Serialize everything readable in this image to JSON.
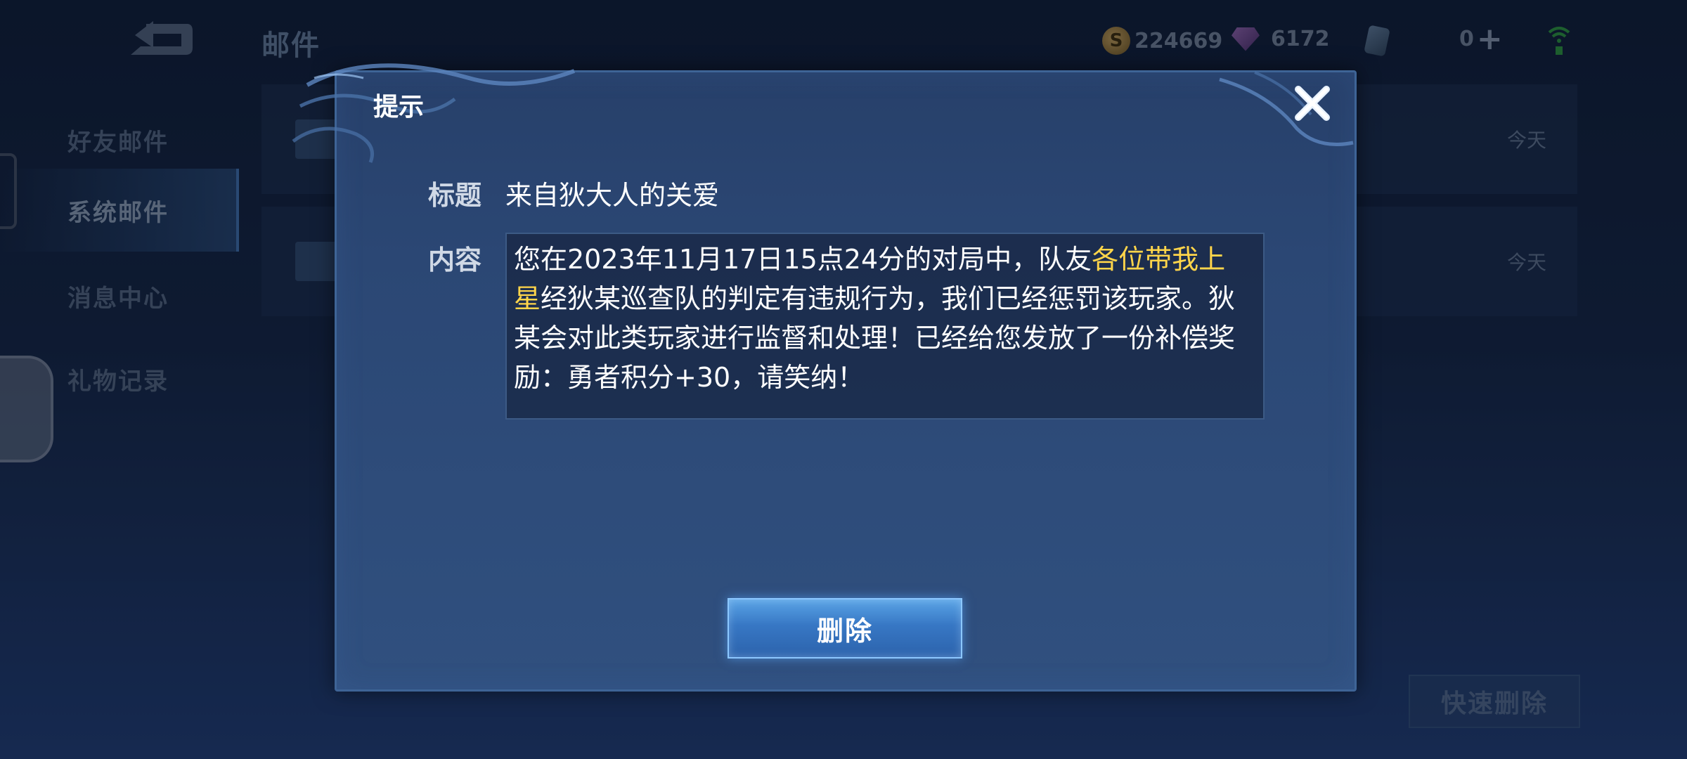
{
  "header": {
    "title": "邮件",
    "gold": "224669",
    "gems": "6172",
    "tickets": "0"
  },
  "sidebar": {
    "items": [
      {
        "label": "好友邮件"
      },
      {
        "label": "系统邮件"
      },
      {
        "label": "消息中心"
      },
      {
        "label": "礼物记录"
      }
    ],
    "active_index": 1
  },
  "mail_list": [
    {
      "date": "今天"
    },
    {
      "date": "今天"
    }
  ],
  "quick_delete_label": "快速删除",
  "dialog": {
    "title": "提示",
    "subject_label": "标题",
    "subject": "来自狄大人的关爱",
    "content_label": "内容",
    "content_prefix": "您在2023年11月17日15点24分的对局中，队友",
    "content_highlight": "各位带我上星",
    "content_suffix": "经狄某巡查队的判定有违规行为，我们已经惩罚该玩家。狄某会对此类玩家进行监督和处理！已经给您发放了一份补偿奖励：勇者积分+30，请笑纳！",
    "delete_label": "删除"
  },
  "colors": {
    "highlight": "#ffd54a",
    "dialog_bg": "#2b4774",
    "button": "#3777c4"
  }
}
